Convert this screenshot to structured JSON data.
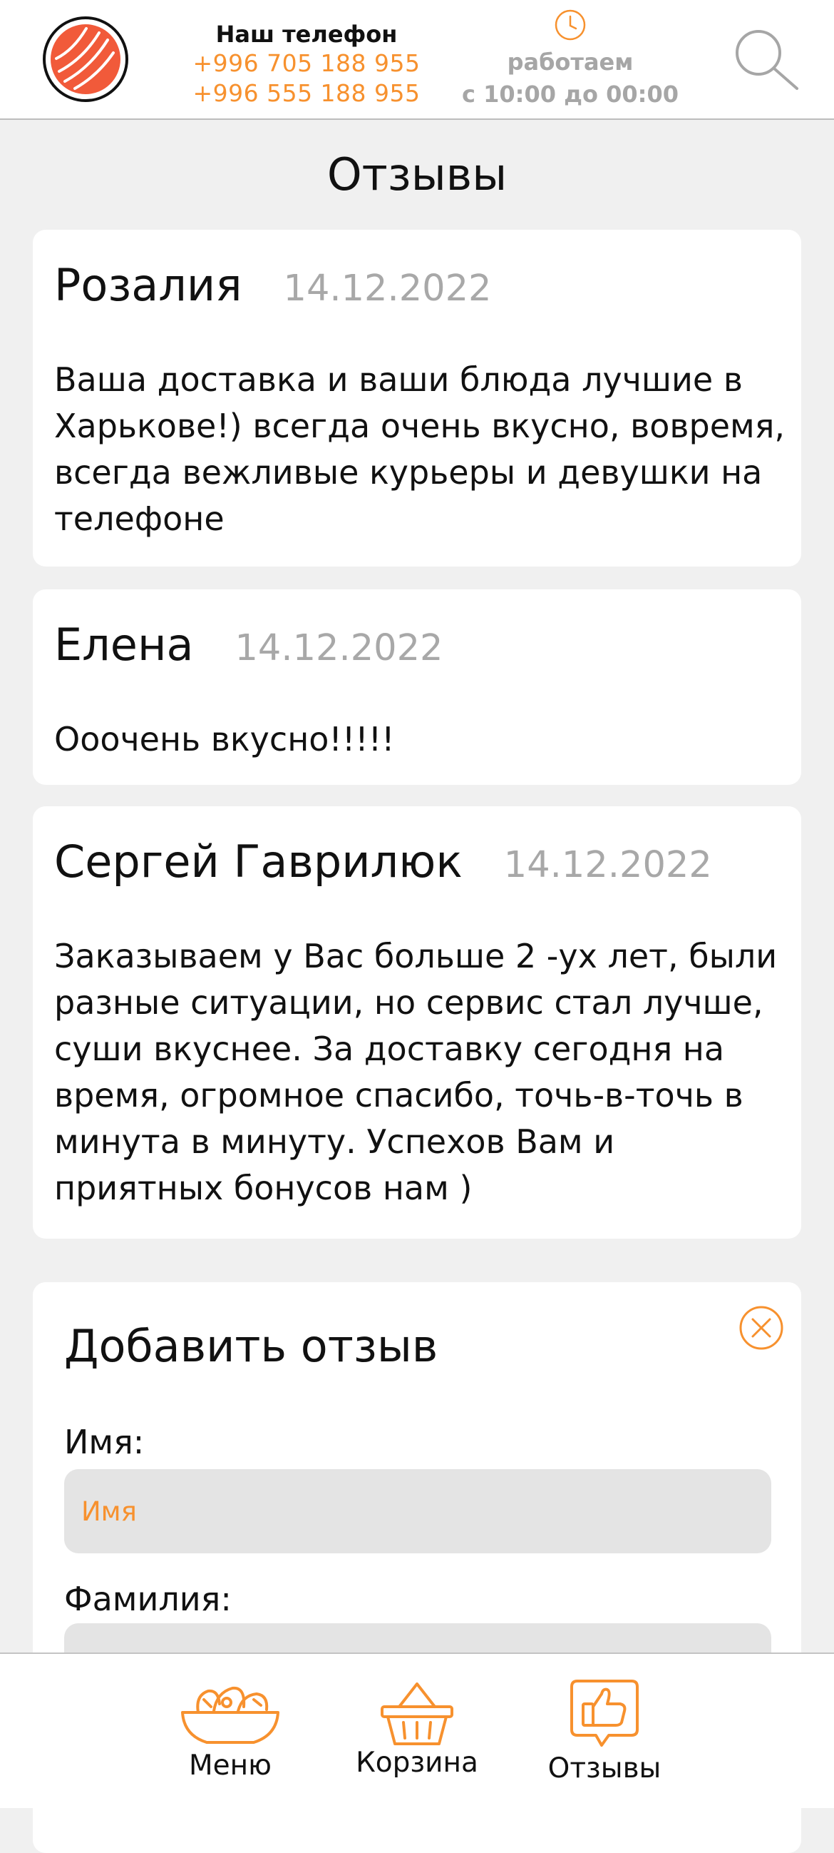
{
  "header": {
    "phone_title": "Наш телефон",
    "phones": [
      "+996 705 188 955",
      "+996 555 188 955"
    ],
    "hours_label": "работаем",
    "hours_time": "с 10:00 до 00:00",
    "logo_icon": "salmon-roll-logo",
    "clock_icon": "clock-icon",
    "search_icon": "search-icon"
  },
  "page_title": "Отзывы",
  "reviews": [
    {
      "name": "Розалия",
      "date": "14.12.2022",
      "text": "Ваша доставка и ваши блюда лучшие в Харькове!) всегда очень вкусно, вовремя, всегда вежливые курьеры и девушки на телефоне"
    },
    {
      "name": "Елена",
      "date": "14.12.2022",
      "text": "Ооочень вкусно!!!!!"
    },
    {
      "name": "Сергей Гаврилюк",
      "date": "14.12.2022",
      "text": "Заказываем у Вас больше 2 -ух лет, были разные ситуации, но сервис стал лучше, суши вкуснее. За доставку сегодня на время, огромное спасибо, точь-в-точь в минута в минуту. Успехов Вам и приятных бонусов нам )"
    }
  ],
  "form": {
    "title": "Добавить отзыв",
    "first_name_label": "Имя:",
    "first_name_placeholder": "Имя",
    "first_name_value": "",
    "last_name_label": "Фамилия:",
    "close_icon": "close-circle-icon"
  },
  "nav": {
    "items": [
      {
        "label": "Меню",
        "icon": "salad-bowl-icon"
      },
      {
        "label": "Корзина",
        "icon": "basket-icon"
      },
      {
        "label": "Отзывы",
        "icon": "thumbs-up-icon"
      }
    ]
  },
  "colors": {
    "accent": "#f7912e",
    "logo_red": "#f15a3a",
    "muted_text": "#a8a8a8",
    "background": "#f0f0f0",
    "input_bg": "#e4e4e4"
  }
}
